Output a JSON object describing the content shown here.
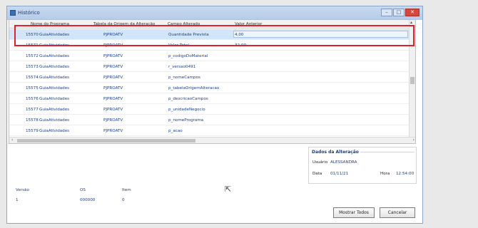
{
  "window": {
    "title": "Histórico"
  },
  "grid": {
    "columns": [
      "Nome do Programa",
      "Tabela da Origem da Alteração",
      "Campo Alterado",
      "Valor Anterior"
    ],
    "rows": [
      {
        "id": "15570",
        "program": "GuiaAtividades",
        "table": "PJPROATV",
        "field": "Quantidade Prevista",
        "prev": "4,00"
      },
      {
        "id": "15571",
        "program": "GuiaAtividades",
        "table": "PJPROATV",
        "field": "Valor Total",
        "prev": "32,00"
      },
      {
        "id": "15572",
        "program": "GuiaAtividades",
        "table": "PJPROATV",
        "field": "p_codigoDoMaterial",
        "prev": ""
      },
      {
        "id": "15573",
        "program": "GuiaAtividades",
        "table": "PJPROATV",
        "field": "r_versao0491",
        "prev": ""
      },
      {
        "id": "15574",
        "program": "GuiaAtividades",
        "table": "PJPROATV",
        "field": "p_nomeCampos",
        "prev": ""
      },
      {
        "id": "15575",
        "program": "GuiaAtividades",
        "table": "PJPROATV",
        "field": "p_tabelaOrigemAlteracao",
        "prev": ""
      },
      {
        "id": "15576",
        "program": "GuiaAtividades",
        "table": "PJPROATV",
        "field": "p_descricaoCampos",
        "prev": ""
      },
      {
        "id": "15577",
        "program": "GuiaAtividades",
        "table": "PJPROATV",
        "field": "p_unidadeNegocio",
        "prev": ""
      },
      {
        "id": "15578",
        "program": "GuiaAtividades",
        "table": "PJPROATV",
        "field": "p_nomePrograma",
        "prev": ""
      },
      {
        "id": "15579",
        "program": "GuiaAtividades",
        "table": "PJPROATV",
        "field": "p_acao",
        "prev": ""
      }
    ]
  },
  "dados": {
    "title": "Dados da Alteração",
    "usuario_label": "Usuário",
    "usuario": "ALESSANDRA",
    "data_label": "Data",
    "data": "01/11/21",
    "hora_label": "Hora",
    "hora": "12:54:00"
  },
  "bottom": {
    "versao_label": "Versão",
    "versao": "1",
    "os_label": "OS",
    "os": "000000",
    "item_label": "Item",
    "item": "0"
  },
  "buttons": {
    "mostrar": "Mostrar Todos",
    "cancelar": "Cancelar"
  },
  "colors": {
    "highlight": "#e0202a",
    "selected_row": "#d3e5f9",
    "text": "#1a3f8a"
  }
}
